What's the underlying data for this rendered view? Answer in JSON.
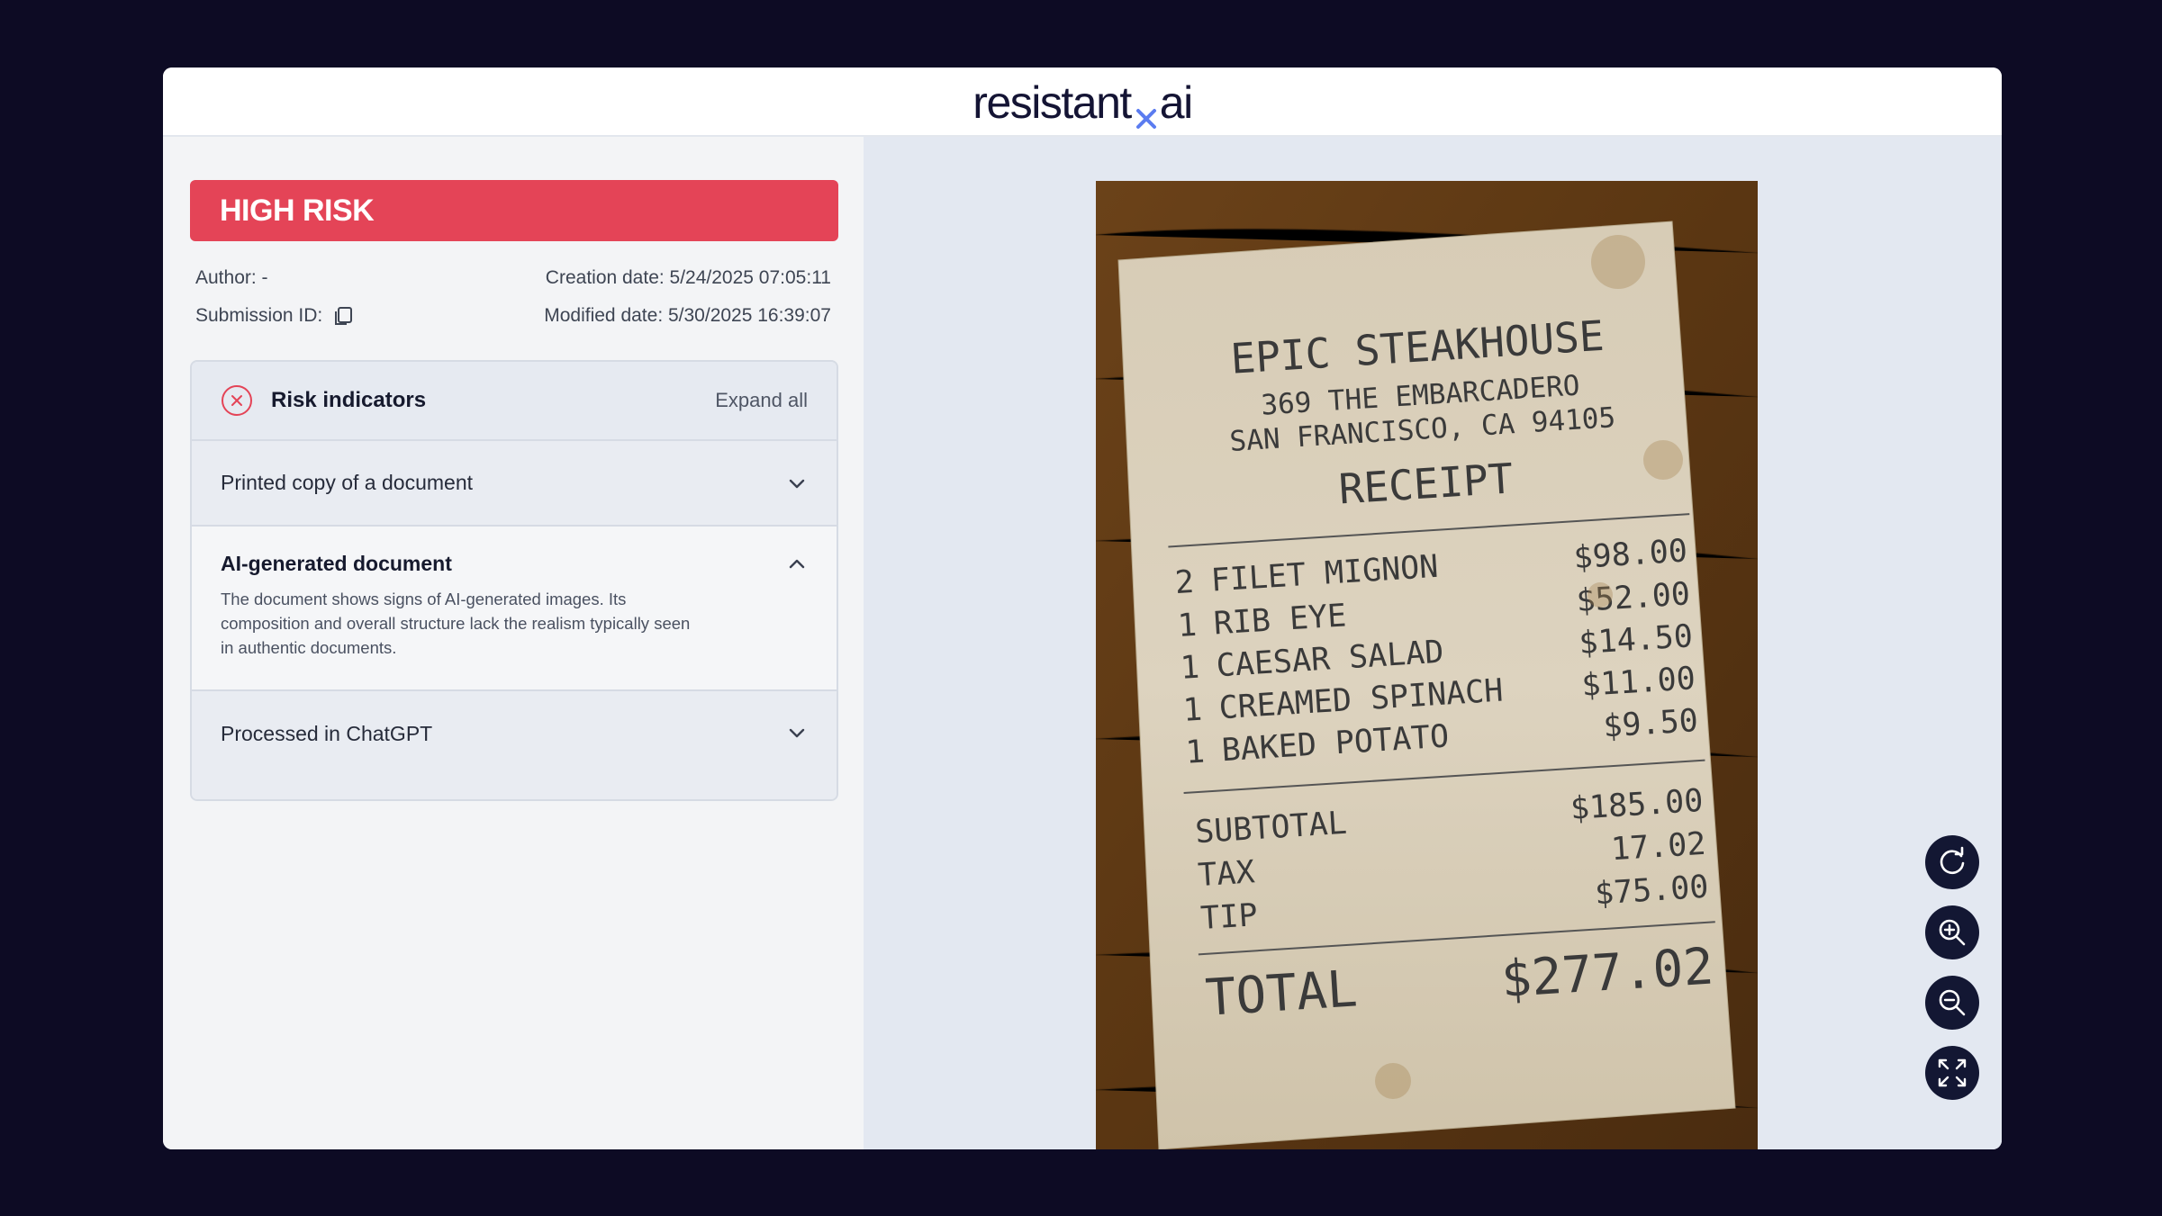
{
  "header": {
    "logo_left": "resistant",
    "logo_right": "ai"
  },
  "risk": {
    "level": "HIGH RISK",
    "color": "#e44457"
  },
  "meta": {
    "author": "Author: -",
    "submission_id": "Submission ID:",
    "creation_date": "Creation date: 5/24/2025 07:05:11",
    "modified_date": "Modified date: 5/30/2025 16:39:07"
  },
  "indicators": {
    "title": "Risk indicators",
    "expand_all": "Expand all",
    "items": [
      {
        "label": "Printed copy of a document",
        "expanded": false
      },
      {
        "label": "AI-generated document",
        "expanded": true,
        "description": "The document shows signs of AI-generated images. Its composition and overall structure lack the realism typically seen in authentic documents."
      },
      {
        "label": "Processed in ChatGPT",
        "expanded": false
      }
    ]
  },
  "receipt": {
    "name": "EPIC STEAKHOUSE",
    "address1": "369 THE EMBARCADERO",
    "address2": "SAN FRANCISCO, CA 94105",
    "heading": "RECEIPT",
    "lines": [
      {
        "qty": "2",
        "item": "FILET MIGNON",
        "price": "$98.00"
      },
      {
        "qty": "1",
        "item": "RIB EYE",
        "price": "$52.00"
      },
      {
        "qty": "1",
        "item": "CAESAR SALAD",
        "price": "$14.50"
      },
      {
        "qty": "1",
        "item": "CREAMED SPINACH",
        "price": "$11.00"
      },
      {
        "qty": "1",
        "item": "BAKED POTATO",
        "price": "$9.50"
      }
    ],
    "subtotal_label": "SUBTOTAL",
    "subtotal": "$185.00",
    "tax_label": "TAX",
    "tax": "17.02",
    "tip_label": "TIP",
    "tip": "$75.00",
    "total_label": "TOTAL",
    "total": "$277.02"
  },
  "controls": {
    "icons": [
      "rotate-icon",
      "zoom-in-icon",
      "zoom-out-icon",
      "fullscreen-icon"
    ]
  }
}
